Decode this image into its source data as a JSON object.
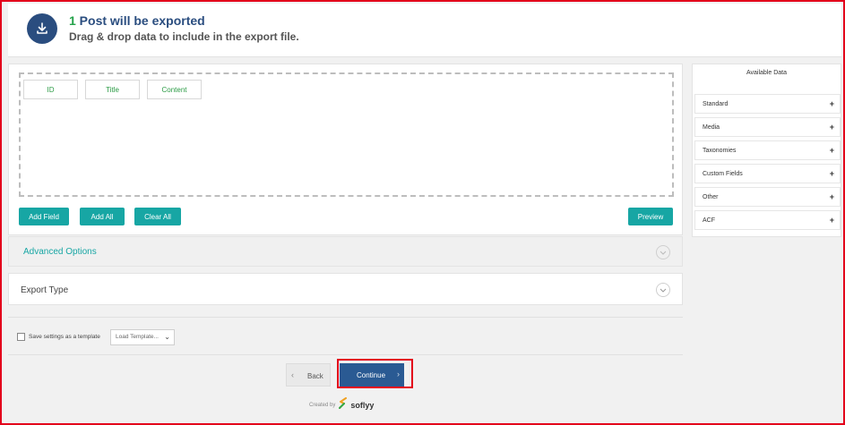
{
  "header": {
    "count": "1",
    "title_rest": " Post will be exported",
    "subtitle": "Drag & drop data to include in the export file."
  },
  "fields": [
    {
      "label": "ID"
    },
    {
      "label": "Title"
    },
    {
      "label": "Content"
    }
  ],
  "actions": {
    "add_field": "Add Field",
    "add_all": "Add All",
    "clear_all": "Clear All",
    "preview": "Preview"
  },
  "sections": {
    "advanced": "Advanced Options",
    "export_type": "Export Type"
  },
  "sidebar": {
    "title": "Available Data",
    "items": [
      {
        "label": "Standard"
      },
      {
        "label": "Media"
      },
      {
        "label": "Taxonomies"
      },
      {
        "label": "Custom Fields"
      },
      {
        "label": "Other"
      },
      {
        "label": "ACF"
      }
    ],
    "plus": "+"
  },
  "template": {
    "checkbox_label": "Save settings as a template",
    "select_value": "Load Template...",
    "caret": "⌄"
  },
  "nav": {
    "back": "Back",
    "continue": "Continue",
    "back_arrow": "‹",
    "next_arrow": "›"
  },
  "footer": {
    "created_by": "Created by",
    "brand": "soflyy"
  },
  "colors": {
    "primary": "#2a4d7f",
    "teal": "#17a6a4",
    "green": "#24a24a",
    "highlight": "#e3001b"
  }
}
